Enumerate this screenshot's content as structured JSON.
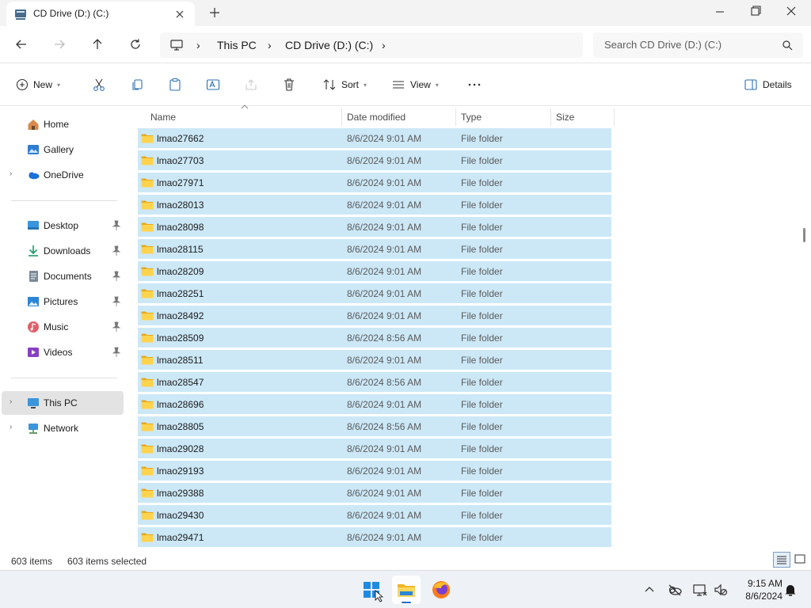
{
  "window": {
    "tab_title": "CD Drive (D:) (C:)"
  },
  "address": {
    "crumbs": [
      "This PC",
      "CD Drive (D:) (C:)"
    ],
    "search_placeholder": "Search CD Drive (D:) (C:)"
  },
  "toolbar": {
    "new_label": "New",
    "sort_label": "Sort",
    "view_label": "View",
    "details_label": "Details"
  },
  "sidebar": {
    "quick": [
      {
        "label": "Home",
        "icon": "home-icon"
      },
      {
        "label": "Gallery",
        "icon": "gallery-icon"
      },
      {
        "label": "OneDrive",
        "icon": "onedrive-icon"
      }
    ],
    "pinned": [
      {
        "label": "Desktop",
        "icon": "desktop-icon"
      },
      {
        "label": "Downloads",
        "icon": "downloads-icon"
      },
      {
        "label": "Documents",
        "icon": "documents-icon"
      },
      {
        "label": "Pictures",
        "icon": "pictures-icon"
      },
      {
        "label": "Music",
        "icon": "music-icon"
      },
      {
        "label": "Videos",
        "icon": "videos-icon"
      }
    ],
    "devices": [
      {
        "label": "This PC",
        "icon": "this-pc-icon",
        "selected": true
      },
      {
        "label": "Network",
        "icon": "network-icon"
      }
    ]
  },
  "columns": {
    "name": "Name",
    "date": "Date modified",
    "type": "Type",
    "size": "Size"
  },
  "files": [
    {
      "name": "lmao27662",
      "date": "8/6/2024 9:01 AM",
      "type": "File folder"
    },
    {
      "name": "lmao27703",
      "date": "8/6/2024 9:01 AM",
      "type": "File folder"
    },
    {
      "name": "lmao27971",
      "date": "8/6/2024 9:01 AM",
      "type": "File folder"
    },
    {
      "name": "lmao28013",
      "date": "8/6/2024 9:01 AM",
      "type": "File folder"
    },
    {
      "name": "lmao28098",
      "date": "8/6/2024 9:01 AM",
      "type": "File folder"
    },
    {
      "name": "lmao28115",
      "date": "8/6/2024 9:01 AM",
      "type": "File folder"
    },
    {
      "name": "lmao28209",
      "date": "8/6/2024 9:01 AM",
      "type": "File folder"
    },
    {
      "name": "lmao28251",
      "date": "8/6/2024 9:01 AM",
      "type": "File folder"
    },
    {
      "name": "lmao28492",
      "date": "8/6/2024 9:01 AM",
      "type": "File folder"
    },
    {
      "name": "lmao28509",
      "date": "8/6/2024 8:56 AM",
      "type": "File folder"
    },
    {
      "name": "lmao28511",
      "date": "8/6/2024 9:01 AM",
      "type": "File folder"
    },
    {
      "name": "lmao28547",
      "date": "8/6/2024 8:56 AM",
      "type": "File folder"
    },
    {
      "name": "lmao28696",
      "date": "8/6/2024 9:01 AM",
      "type": "File folder"
    },
    {
      "name": "lmao28805",
      "date": "8/6/2024 8:56 AM",
      "type": "File folder"
    },
    {
      "name": "lmao29028",
      "date": "8/6/2024 9:01 AM",
      "type": "File folder"
    },
    {
      "name": "lmao29193",
      "date": "8/6/2024 9:01 AM",
      "type": "File folder"
    },
    {
      "name": "lmao29388",
      "date": "8/6/2024 9:01 AM",
      "type": "File folder"
    },
    {
      "name": "lmao29430",
      "date": "8/6/2024 9:01 AM",
      "type": "File folder"
    },
    {
      "name": "lmao29471",
      "date": "8/6/2024 9:01 AM",
      "type": "File folder"
    }
  ],
  "status": {
    "item_count": "603 items",
    "selected_count": "603 items selected"
  },
  "clock": {
    "time": "9:15 AM",
    "date": "8/6/2024"
  },
  "colors": {
    "selection": "#cce8f7",
    "folder": "#f5c542",
    "accent": "#0067c0"
  }
}
